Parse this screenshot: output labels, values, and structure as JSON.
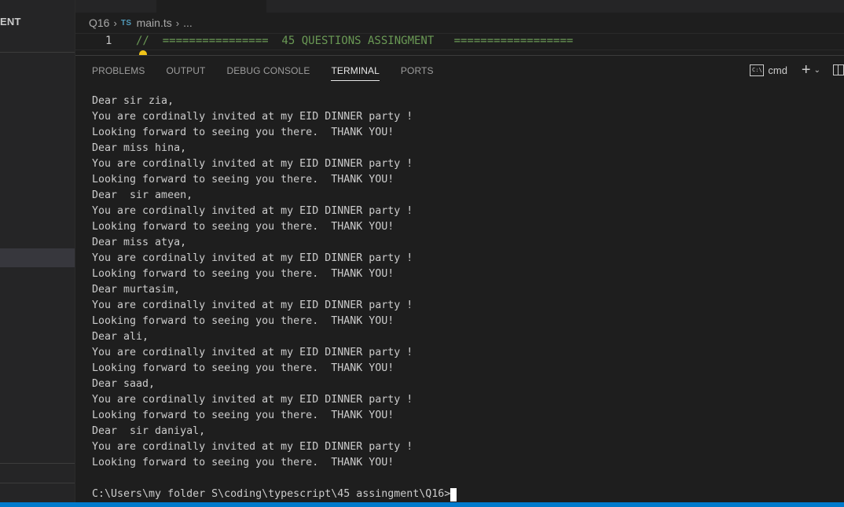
{
  "sidebar": {
    "title": "ENT"
  },
  "breadcrumb": {
    "folder": "Q16",
    "file_icon": "TS",
    "file": "main.ts",
    "more": "..."
  },
  "editor": {
    "line_number": "1",
    "line_text": "//  ================  45 QUESTIONS ASSINGMENT   =================="
  },
  "panel": {
    "tabs": [
      {
        "label": "PROBLEMS",
        "active": false
      },
      {
        "label": "OUTPUT",
        "active": false
      },
      {
        "label": "DEBUG CONSOLE",
        "active": false
      },
      {
        "label": "TERMINAL",
        "active": true
      },
      {
        "label": "PORTS",
        "active": false
      }
    ],
    "shell_icon_text": "C:\\",
    "shell_label": "cmd"
  },
  "terminal": {
    "lines": [
      "Dear sir zia,",
      "You are cordinally invited at my EID DINNER party !",
      "Looking forward to seeing you there.  THANK YOU!",
      "Dear miss hina,",
      "You are cordinally invited at my EID DINNER party !",
      "Looking forward to seeing you there.  THANK YOU!",
      "Dear  sir ameen,",
      "You are cordinally invited at my EID DINNER party !",
      "Looking forward to seeing you there.  THANK YOU!",
      "Dear miss atya,",
      "You are cordinally invited at my EID DINNER party !",
      "Looking forward to seeing you there.  THANK YOU!",
      "Dear murtasim,",
      "You are cordinally invited at my EID DINNER party !",
      "Looking forward to seeing you there.  THANK YOU!",
      "Dear ali,",
      "You are cordinally invited at my EID DINNER party !",
      "Looking forward to seeing you there.  THANK YOU!",
      "Dear saad,",
      "You are cordinally invited at my EID DINNER party !",
      "Looking forward to seeing you there.  THANK YOU!",
      "Dear  sir daniyal,",
      "You are cordinally invited at my EID DINNER party !",
      "Looking forward to seeing you there.  THANK YOU!"
    ],
    "prompt": "C:\\Users\\my folder S\\coding\\typescript\\45 assingment\\Q16>"
  },
  "colors": {
    "background": "#1e1e1e",
    "sidebar": "#252526",
    "comment": "#6a9955",
    "statusbar": "#007acc",
    "ts_icon": "#519aba"
  }
}
